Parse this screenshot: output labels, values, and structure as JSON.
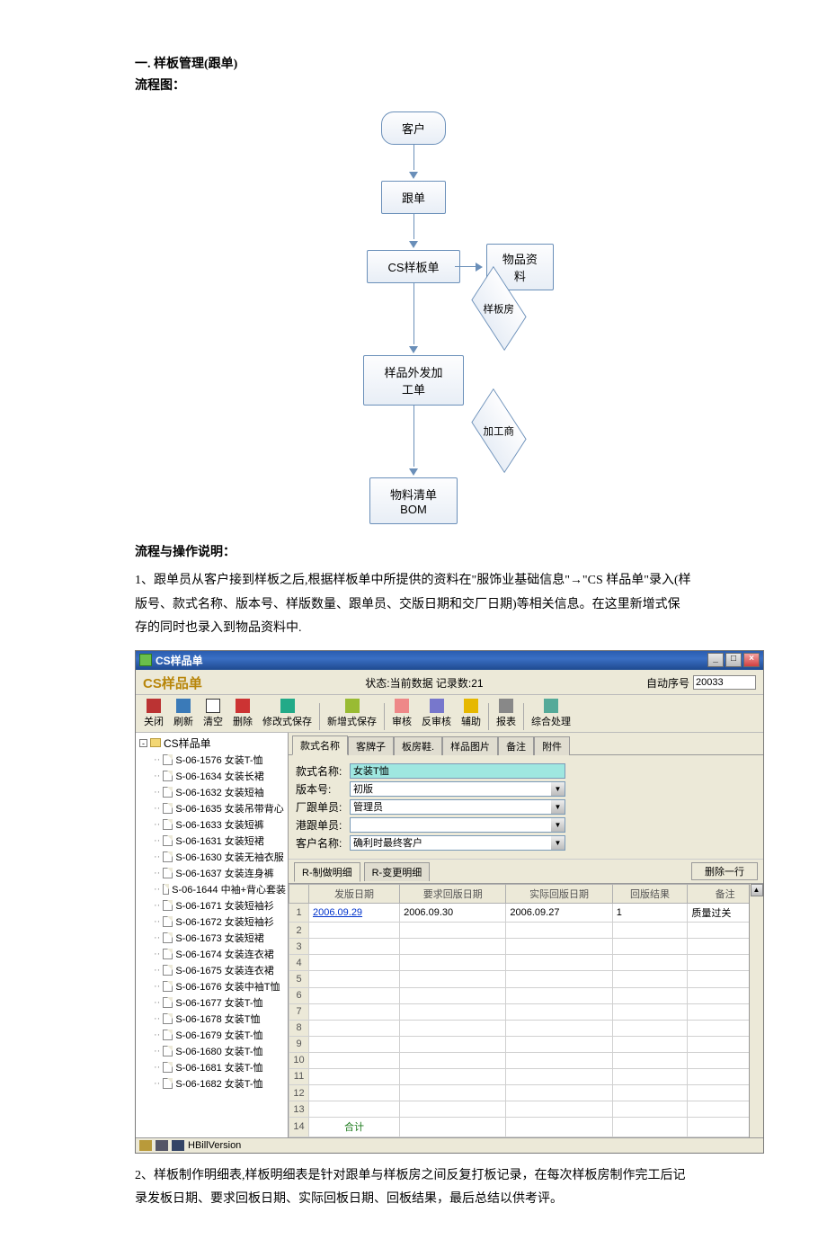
{
  "doc": {
    "heading": "一. 样板管理(跟单)",
    "flow_label": "流程图：",
    "explain_label": "流程与操作说明：",
    "para1": "1、跟单员从客户接到样板之后,根据样板单中所提供的资料在\"服饰业基础信息\"→\"CS 样品单\"录入(样版号、款式名称、版本号、样版数量、跟单员、交版日期和交厂日期)等相关信息。在这里新增式保存的同时也录入到物品资料中.",
    "para2": "2、样板制作明细表,样板明细表是针对跟单与样板房之间反复打板记录，在每次样板房制作完工后记录发板日期、要求回板日期、实际回板日期、回板结果，最后总结以供考评。"
  },
  "flow": {
    "n1": "客户",
    "n2": "跟单",
    "n3": "CS样板单",
    "n3b": "物品资料",
    "d1": "样板房",
    "n4a": "样品外发加",
    "n4b": "工单",
    "d2": "加工商",
    "n5a": "物料清单",
    "n5b": "BOM"
  },
  "app": {
    "title": "CS样品单",
    "form_title": "CS样品单",
    "status": "状态:当前数据 记录数:21",
    "auto_label": "自动序号",
    "auto_value": "20033",
    "toolbar": {
      "close": "关闭",
      "refresh": "刷新",
      "clear": "清空",
      "del": "删除",
      "save1": "修改式保存",
      "save2": "新增式保存",
      "audit": "审核",
      "unaudit": "反审核",
      "help": "辅助",
      "report": "报表",
      "combo": "综合处理"
    },
    "tree": {
      "root": "CS样品单",
      "items": [
        "S-06-1576 女装T-恤",
        "S-06-1634 女装长裙",
        "S-06-1632 女装短袖",
        "S-06-1635 女装吊带背心",
        "S-06-1633 女装短裤",
        "S-06-1631 女装短裙",
        "S-06-1630 女装无袖衣服",
        "S-06-1637 女装连身裤",
        "S-06-1644 中袖+背心套装",
        "S-06-1671 女装短袖衫",
        "S-06-1672 女装短袖衫",
        "S-06-1673 女装短裙",
        "S-06-1674 女装连衣裙",
        "S-06-1675 女装连衣裙",
        "S-06-1676 女装中袖T恤",
        "S-06-1677 女装T-恤",
        "S-06-1678 女装T恤",
        "S-06-1679 女装T-恤",
        "S-06-1680 女装T-恤",
        "S-06-1681 女装T-恤",
        "S-06-1682 女装T-恤"
      ]
    },
    "tabs": {
      "t1": "款式名称",
      "t2": "客牌子",
      "t3": "板房鞋.",
      "t4": "样品图片",
      "t5": "备注",
      "t6": "附件"
    },
    "form": {
      "l_name": "款式名称:",
      "v_name": "女装T恤",
      "l_ver": "版本号:",
      "v_ver": "初版",
      "l_fac": "厂跟单员:",
      "v_fac": "管理员",
      "l_hk": "港跟单员:",
      "v_hk": "",
      "l_cust": "客户名称:",
      "v_cust": "确利时最终客户"
    },
    "subtabs": {
      "t1": "R-制做明细",
      "t2": "R-变更明细",
      "del": "删除一行"
    },
    "grid": {
      "cols": [
        "发版日期",
        "要求回版日期",
        "实际回版日期",
        "回版结果",
        "备注"
      ],
      "row1": {
        "c1": "2006.09.29",
        "c2": "2006.09.30",
        "c3": "2006.09.27",
        "c4": "1",
        "c5": "质量过关"
      },
      "sum": "合计"
    },
    "statusbar": "HBillVersion"
  }
}
